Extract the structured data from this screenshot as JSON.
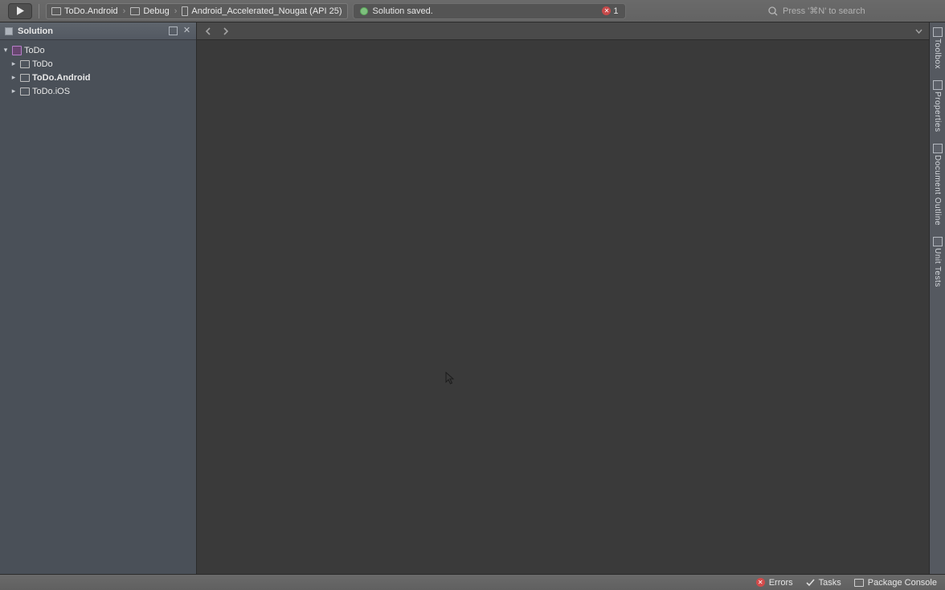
{
  "toolbar": {
    "target_project": "ToDo.Android",
    "target_config": "Debug",
    "target_device": "Android_Accelerated_Nougat (API 25)",
    "status_message": "Solution saved.",
    "error_count": "1",
    "search_placeholder": "Press '⌘N' to search"
  },
  "solution": {
    "title": "Solution",
    "root": "ToDo",
    "items": [
      {
        "label": "ToDo",
        "bold": false
      },
      {
        "label": "ToDo.Android",
        "bold": true
      },
      {
        "label": "ToDo.iOS",
        "bold": false
      }
    ]
  },
  "right_pads": [
    "Toolbox",
    "Properties",
    "Document Outline",
    "Unit Tests"
  ],
  "statusbar": {
    "errors": "Errors",
    "tasks": "Tasks",
    "package_console": "Package Console"
  }
}
